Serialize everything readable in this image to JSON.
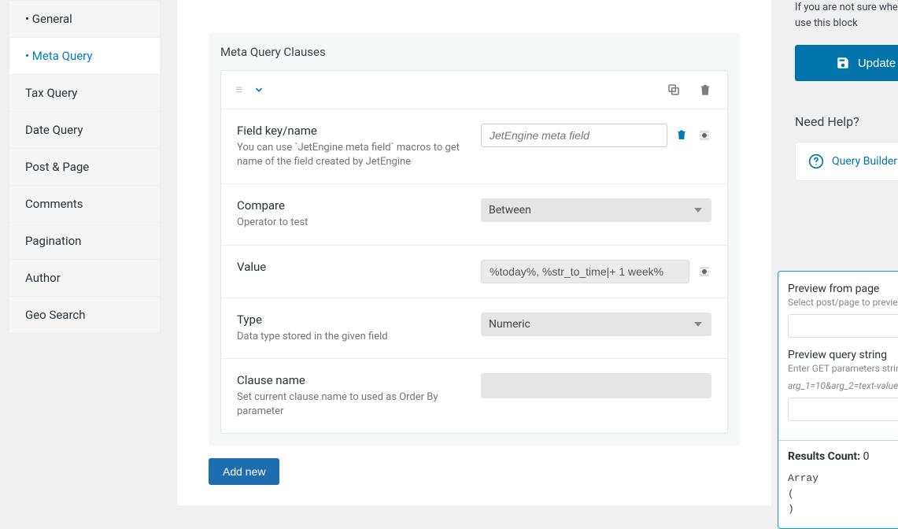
{
  "sidebar": {
    "items": [
      {
        "label": "General",
        "bullet": true,
        "active": false
      },
      {
        "label": "Meta Query",
        "bullet": true,
        "active": true
      },
      {
        "label": "Tax Query",
        "bullet": false,
        "active": false
      },
      {
        "label": "Date Query",
        "bullet": false,
        "active": false
      },
      {
        "label": "Post & Page",
        "bullet": false,
        "active": false
      },
      {
        "label": "Comments",
        "bullet": false,
        "active": false
      },
      {
        "label": "Pagination",
        "bullet": false,
        "active": false
      },
      {
        "label": "Author",
        "bullet": false,
        "active": false
      },
      {
        "label": "Geo Search",
        "bullet": false,
        "active": false
      }
    ]
  },
  "panel": {
    "title": "Meta Query Clauses",
    "fields": {
      "field_key": {
        "label": "Field key/name",
        "desc": "You can use `JetEngine meta field` macros to get name of the field created by JetEngine",
        "placeholder": "JetEngine meta field"
      },
      "compare": {
        "label": "Compare",
        "desc": "Operator to test",
        "value": "Between"
      },
      "value": {
        "label": "Value",
        "value": "%today%, %str_to_time|+ 1 week%"
      },
      "type": {
        "label": "Type",
        "desc": "Data type stored in the given field",
        "value": "Numeric"
      },
      "clause_name": {
        "label": "Clause name",
        "desc": "Set current clause name to used as Order By parameter"
      }
    },
    "add_new": "Add new"
  },
  "right": {
    "help_text": "If you are not sure where to use this block",
    "update_label": "Update",
    "need_help_title": "Need Help?",
    "help_link": "Query Builder"
  },
  "preview": {
    "from_page_label": "Preview from page",
    "from_page_sub": "Select post/page to preview",
    "query_string_label": "Preview query string",
    "query_string_sub": "Enter GET parameters string",
    "query_string_example": "arg_1=10&arg_2=text-value",
    "results_label": "Results Count:",
    "results_value": "0",
    "code": "Array\n(\n)"
  }
}
